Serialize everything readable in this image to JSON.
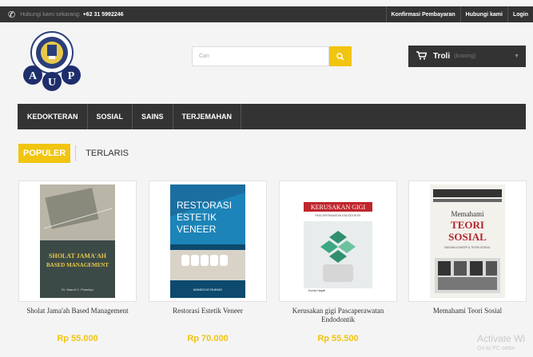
{
  "topbar": {
    "phone_label": "Hubungi kami sekarang:",
    "phone_number": "+62 31 5992246",
    "links": [
      "Konfirmasi Pembayaran",
      "Hubungi kami",
      "Login"
    ]
  },
  "search": {
    "placeholder": "Cari"
  },
  "cart": {
    "label": "Troli",
    "status": "(kosong)"
  },
  "nav": {
    "items": [
      "KEDOKTERAN",
      "SOSIAL",
      "SAINS",
      "TERJEMAHAN"
    ]
  },
  "tabs": {
    "items": [
      "POPULER",
      "TERLARIS"
    ],
    "active": "POPULER"
  },
  "products": [
    {
      "name": "Sholat Jama'ah Based Management",
      "price": "Rp 55.000",
      "cover_title": "SHOLAT JAMA'AH BASED MANAGEMENT"
    },
    {
      "name": "Restorasi Estetik Veneer",
      "price": "Rp 70.000",
      "cover_title": "RESTORASI ESTETIK VENEER"
    },
    {
      "name": "Kerusakan gigi Pascaperawatan Endodontik",
      "price": "Rp 55.500",
      "cover_title": "KERUSAKAN GIGI"
    },
    {
      "name": "Memahami Teori Sosial",
      "price": "",
      "cover_title": "Memahami TEORI SOSIAL"
    }
  ],
  "watermark": {
    "title": "Activate Wi",
    "sub": "Go to PC settin"
  },
  "colors": {
    "accent": "#f1c40f",
    "dark": "#333333"
  }
}
